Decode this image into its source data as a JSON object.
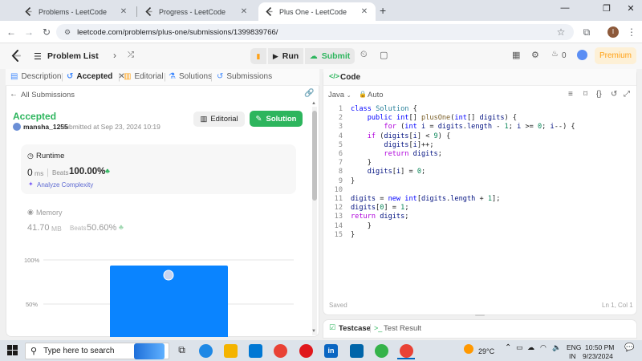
{
  "browser": {
    "tabs": [
      {
        "title": "Problems - LeetCode"
      },
      {
        "title": "Progress - LeetCode"
      },
      {
        "title": "Plus One - LeetCode"
      }
    ],
    "new_tab": "+",
    "url": "leetcode.com/problems/plus-one/submissions/1399839766/",
    "profile_initial": "I"
  },
  "toolbar": {
    "problem_list": "Problem List",
    "run": "Run",
    "submit": "Submit",
    "fire_count": "0",
    "premium": "Premium"
  },
  "left_tabs": [
    "Description",
    "Accepted",
    "Editorial",
    "Solutions",
    "Submissions"
  ],
  "submission": {
    "back": "All Submissions",
    "status": "Accepted",
    "user": "mansha_1255",
    "submitted_text": "submitted at Sep 23, 2024 10:19",
    "editorial_btn": "Editorial",
    "solution_btn": "Solution",
    "runtime_label": "Runtime",
    "runtime_value": "0",
    "runtime_unit": "ms",
    "runtime_beats_label": "Beats",
    "runtime_beats": "100.00%",
    "analyze": "Analyze Complexity",
    "memory_label": "Memory",
    "memory_value": "41.70",
    "memory_unit": "MB",
    "memory_beats_label": "Beats",
    "memory_beats": "50.60%"
  },
  "chart_data": {
    "type": "bar",
    "ytick_labels": [
      "100%",
      "50%"
    ],
    "bar_color": "#0a84ff",
    "bars": [
      {
        "value": 100
      }
    ]
  },
  "code_panel": {
    "title": "Code",
    "language": "Java",
    "auto": "Auto",
    "lines": [
      "class Solution {",
      "    public int[] plusOne(int[] digits) {",
      "        for (int i = digits.length - 1; i >= 0; i--) {",
      "    if (digits[i] < 9) {",
      "        digits[i]++;",
      "        return digits;",
      "    }",
      "    digits[i] = 0;",
      "}",
      "",
      "digits = new int[digits.length + 1];",
      "digits[0] = 1;",
      "return digits;",
      "    }",
      "}"
    ],
    "saved": "Saved",
    "position": "Ln 1, Col 1"
  },
  "bottom_tabs": {
    "testcase": "Testcase",
    "result": "Test Result"
  },
  "taskbar": {
    "search_placeholder": "Type here to search",
    "weather": "29°C",
    "lang1": "ENG",
    "lang2": "IN",
    "time": "10:50 PM",
    "date": "9/23/2024"
  },
  "colors": {
    "accent_green": "#2db55d",
    "accent_orange": "#ffa116",
    "bar_blue": "#0a84ff"
  }
}
